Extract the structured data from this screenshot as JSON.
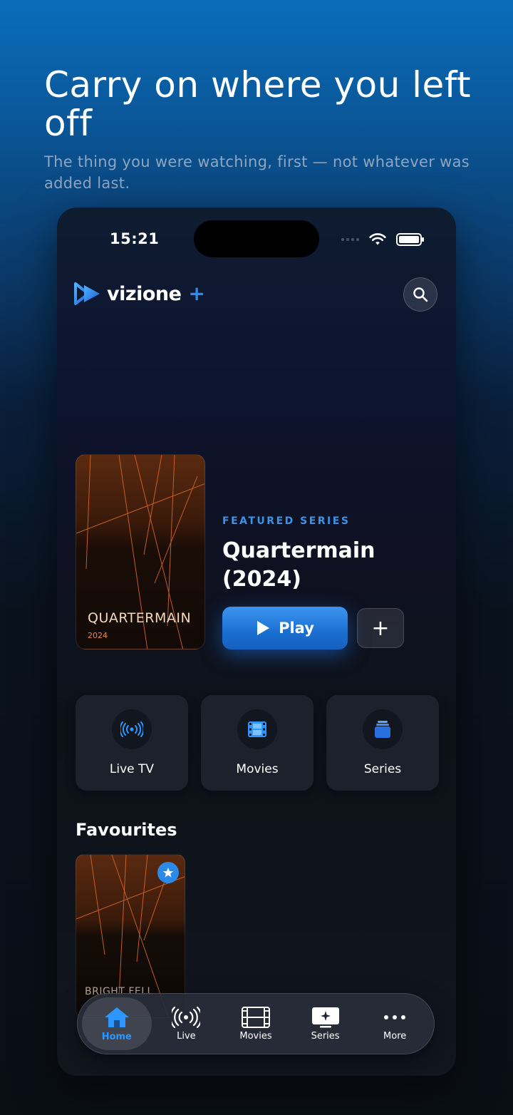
{
  "hero": {
    "title": "Carry on where you left off",
    "subtitle": "The thing you were watching, first — not whatever was added last."
  },
  "status_bar": {
    "time": "15:21"
  },
  "app": {
    "logo_text": "vizione",
    "logo_plus": "+",
    "search_icon": "search-icon"
  },
  "featured": {
    "label": "FEATURED SERIES",
    "title": "Quartermain (2024)",
    "poster_title": "QUARTERMAIN",
    "poster_year": "2024",
    "play_label": "Play",
    "add_label": "+"
  },
  "categories": [
    {
      "label": "Live TV",
      "icon": "broadcast-icon"
    },
    {
      "label": "Movies",
      "icon": "film-icon"
    },
    {
      "label": "Series",
      "icon": "stack-icon"
    }
  ],
  "favourites": {
    "title": "Favourites",
    "items": [
      {
        "poster_title": "BRIGHT FELL"
      }
    ]
  },
  "tabbar": {
    "items": [
      {
        "label": "Home",
        "icon": "home-icon",
        "active": true
      },
      {
        "label": "Live",
        "icon": "broadcast-icon"
      },
      {
        "label": "Movies",
        "icon": "film-icon"
      },
      {
        "label": "Series",
        "icon": "tv-sparkle-icon"
      },
      {
        "label": "More",
        "icon": "more-icon"
      }
    ]
  },
  "colors": {
    "accent": "#2e96ff",
    "primary_button": "#1a6fd0",
    "card": "#1c212b"
  }
}
